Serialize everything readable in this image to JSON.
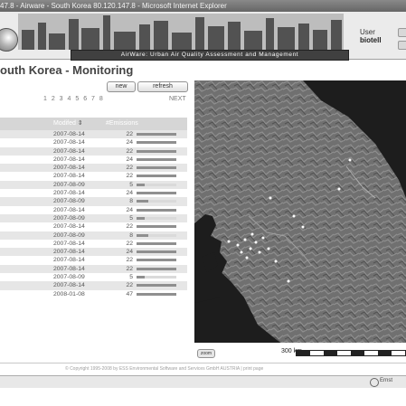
{
  "window": {
    "title": "47.8 - Airware - South Korea 80.120.147.8 - Microsoft Internet Explorer"
  },
  "banner": {
    "tagline": "AirWare: Urban Air Quality Assessment and Management",
    "user_label": "User",
    "user_name": "biotell"
  },
  "page": {
    "title": "outh Korea - Monitoring",
    "new_button": "new",
    "refresh_button": "refresh",
    "pager_pages": "1 2 3 4 5 6 7 8",
    "pager_next": "NEXT"
  },
  "table": {
    "headers": {
      "modified": "Modifed",
      "emissions": "#Emissions"
    },
    "rows": [
      {
        "modified": "2007-08-14",
        "count": "22",
        "level": 1.0
      },
      {
        "modified": "2007-08-14",
        "count": "24",
        "level": 1.0
      },
      {
        "modified": "2007-08-14",
        "count": "22",
        "level": 1.0
      },
      {
        "modified": "2007-08-14",
        "count": "24",
        "level": 1.0
      },
      {
        "modified": "2007-08-14",
        "count": "22",
        "level": 1.0
      },
      {
        "modified": "2007-08-14",
        "count": "22",
        "level": 1.0
      },
      {
        "modified": "2007-08-09",
        "count": "5",
        "level": 0.2
      },
      {
        "modified": "2007-08-14",
        "count": "24",
        "level": 1.0
      },
      {
        "modified": "2007-08-09",
        "count": "8",
        "level": 0.3
      },
      {
        "modified": "2007-08-14",
        "count": "24",
        "level": 1.0
      },
      {
        "modified": "2007-08-09",
        "count": "5",
        "level": 0.2
      },
      {
        "modified": "2007-08-14",
        "count": "22",
        "level": 1.0
      },
      {
        "modified": "2007-08-09",
        "count": "8",
        "level": 0.3
      },
      {
        "modified": "2007-08-14",
        "count": "22",
        "level": 1.0
      },
      {
        "modified": "2007-08-14",
        "count": "24",
        "level": 1.0
      },
      {
        "modified": "2007-08-14",
        "count": "22",
        "level": 1.0
      },
      {
        "modified": "2007-08-14",
        "count": "22",
        "level": 1.0
      },
      {
        "modified": "2007-08-09",
        "count": "5",
        "level": 0.2
      },
      {
        "modified": "2007-08-14",
        "count": "22",
        "level": 1.0
      },
      {
        "modified": "2008-01-08",
        "count": "47",
        "level": 1.0
      }
    ]
  },
  "map": {
    "zoom_button": "zoom",
    "scale_label": "300 km"
  },
  "footer": {
    "text": "© Copyright 1995-2008 by ESS Environmental Software and Services GmbH AUSTRIA | print page"
  },
  "statusbar": {
    "zone": "Ernst"
  }
}
